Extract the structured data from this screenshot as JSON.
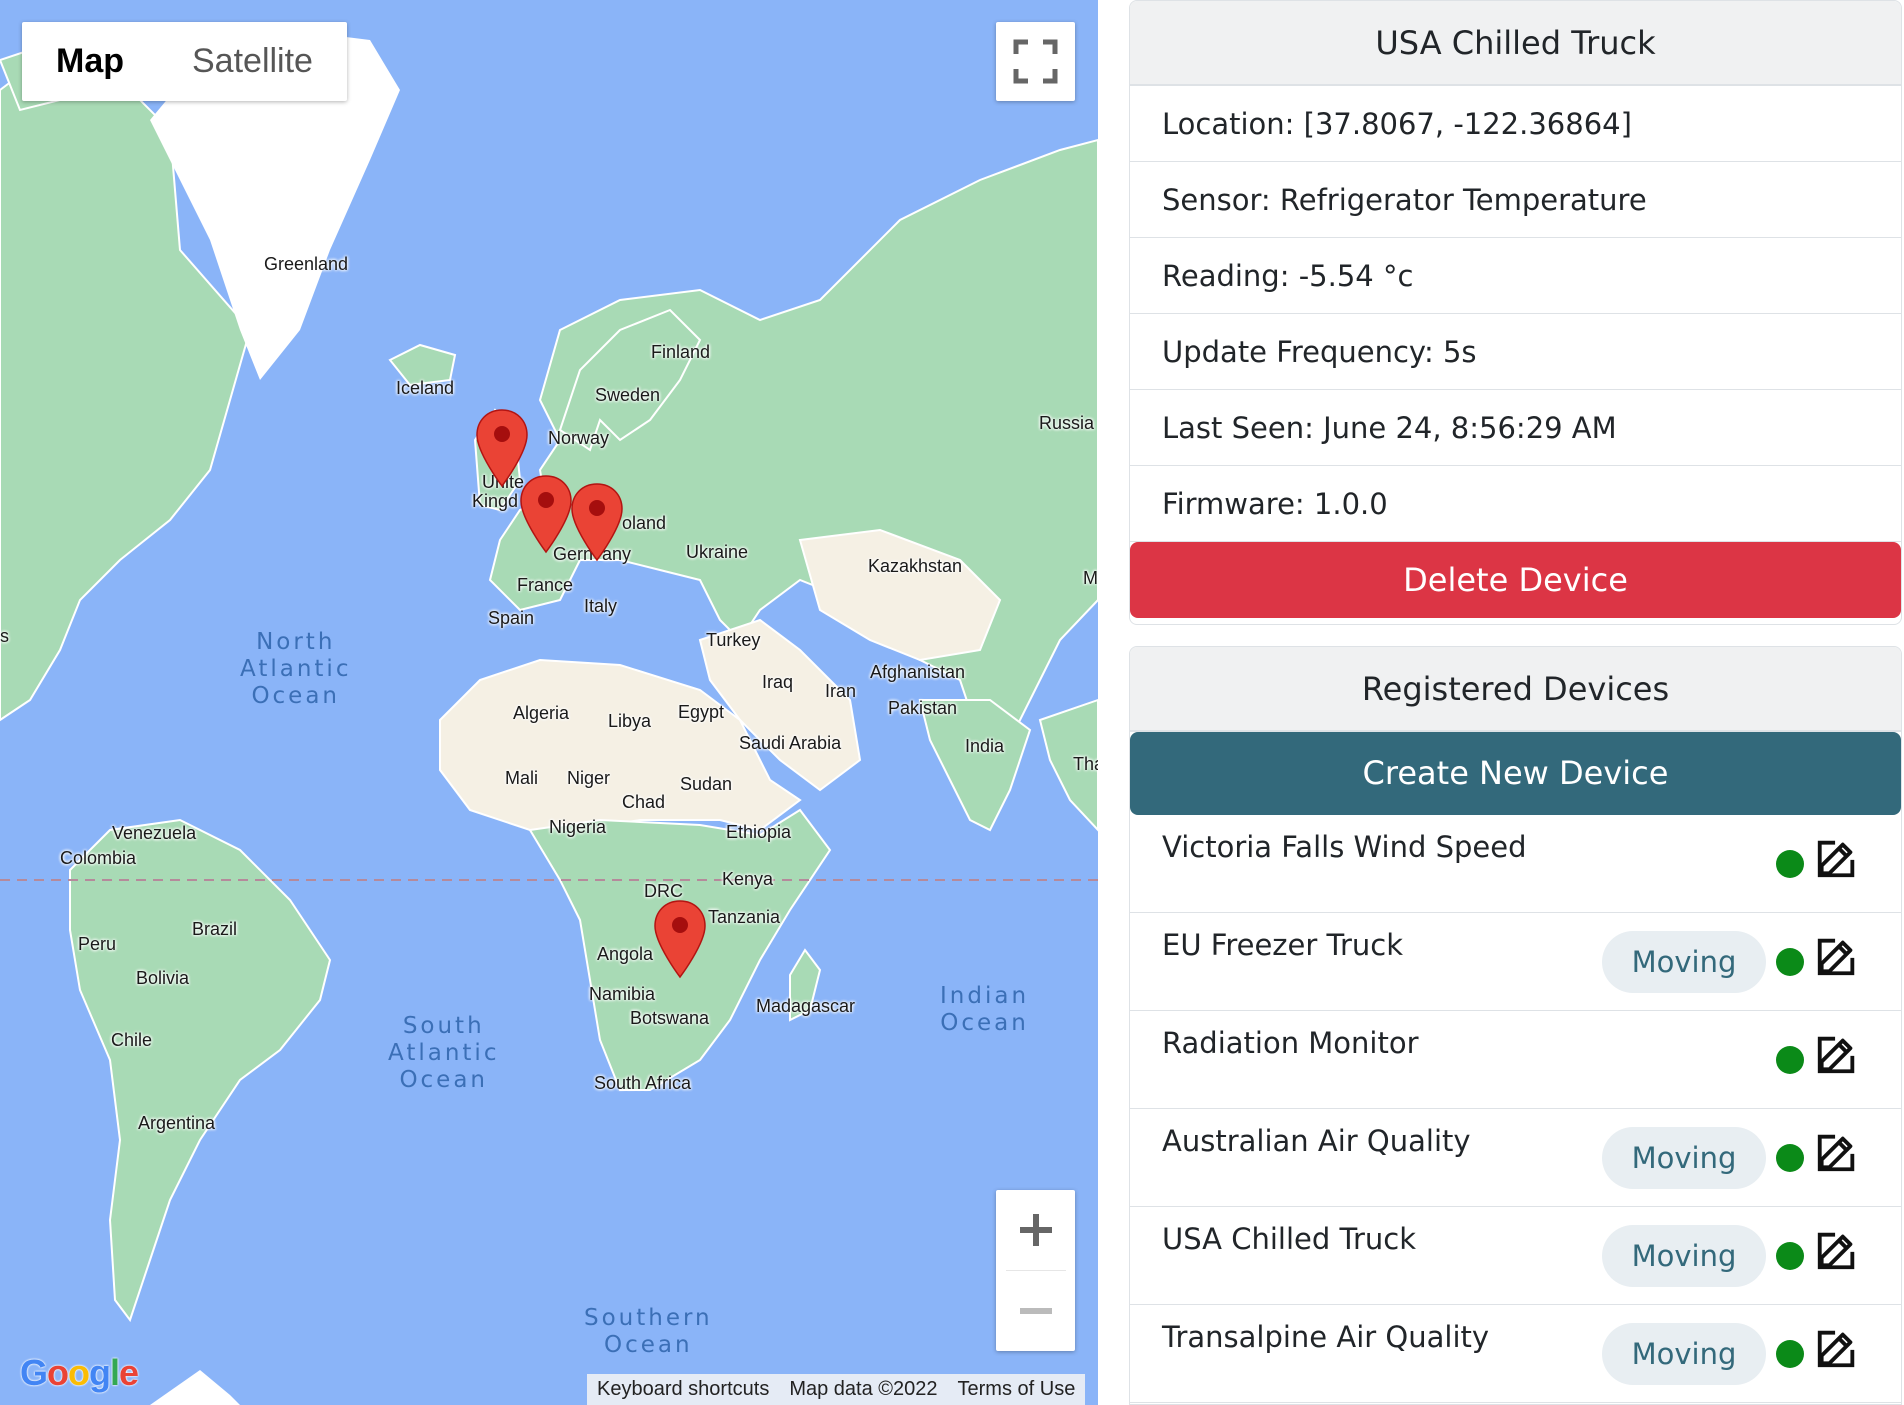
{
  "map": {
    "type_control": {
      "map_label": "Map",
      "satellite_label": "Satellite",
      "active": "map"
    },
    "labels": {
      "greenland": "Greenland",
      "iceland": "Iceland",
      "finland": "Finland",
      "sweden": "Sweden",
      "norway": "Norway",
      "russia": "Russia",
      "united": "Unite",
      "kingdom": "Kingd",
      "poland": "oland",
      "germany_a": "Gern",
      "germany_b": "any",
      "ukraine": "Ukraine",
      "kazakhstan": "Kazakhstan",
      "mongolia_cut": "M",
      "france": "France",
      "italy": "Italy",
      "spain": "Spain",
      "turkey": "Turkey",
      "iraq": "Iraq",
      "iran": "Iran",
      "afghanistan": "Afghanistan",
      "pakistan": "Pakistan",
      "india": "India",
      "thailand_cut": "Tha",
      "algeria": "Algeria",
      "libya": "Libya",
      "egypt": "Egypt",
      "saudi_arabia": "Saudi Arabia",
      "mali": "Mali",
      "niger": "Niger",
      "chad": "Chad",
      "sudan": "Sudan",
      "nigeria": "Nigeria",
      "ethiopia": "Ethiopia",
      "kenya": "Kenya",
      "drc": "DRC",
      "tanzania": "Tanzania",
      "angola": "Angola",
      "namibia": "Namibia",
      "botswana": "Botswana",
      "madagascar": "Madagascar",
      "south_africa": "South Africa",
      "venezuela": "Venezuela",
      "colombia": "Colombia",
      "peru": "Peru",
      "brazil": "Brazil",
      "bolivia": "Bolivia",
      "chile": "Chile",
      "argentina": "Argentina",
      "left_cut": "s"
    },
    "oceans": {
      "north_atlantic": "North\nAtlantic\nOcean",
      "south_atlantic": "South\nAtlantic\nOcean",
      "indian": "Indian\nOcean",
      "southern": "Southern\nOcean"
    },
    "attribution": {
      "keyboard": "Keyboard shortcuts",
      "data": "Map data ©2022",
      "terms": "Terms of Use"
    },
    "logo": "Google",
    "colors": {
      "water": "#8ab4f8",
      "land": "#a8dab5",
      "desert": "#f5f0e4",
      "marker": "#ea4335"
    }
  },
  "device_detail": {
    "title": "USA Chilled Truck",
    "location": "Location: [37.8067, -122.36864]",
    "sensor": "Sensor: Refrigerator Temperature",
    "reading": "Reading: -5.54 °c",
    "frequency": "Update Frequency: 5s",
    "last_seen": "Last Seen: June 24, 8:56:29 AM",
    "firmware": "Firmware: 1.0.0",
    "delete_label": "Delete Device",
    "delete_color": "#dc3545"
  },
  "registered": {
    "title": "Registered Devices",
    "create_label": "Create New Device",
    "create_color": "#33697b",
    "status_color": "#0b8a18",
    "devices": [
      {
        "name": "Victoria Falls Wind Speed",
        "badge": ""
      },
      {
        "name": "EU Freezer Truck",
        "badge": "Moving"
      },
      {
        "name": "Radiation Monitor",
        "badge": ""
      },
      {
        "name": "Australian Air Quality",
        "badge": "Moving"
      },
      {
        "name": "USA Chilled Truck",
        "badge": "Moving"
      },
      {
        "name": "Transalpine Air Quality",
        "badge": "Moving"
      }
    ]
  }
}
